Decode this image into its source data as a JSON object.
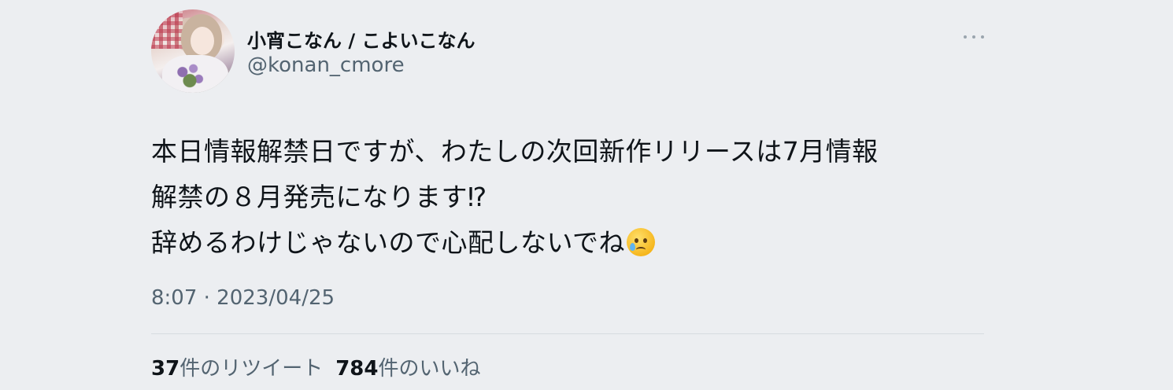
{
  "tweet": {
    "author": {
      "name": "小宵こなん / こよいこなん",
      "handle": "@konan_cmore"
    },
    "text_lines": [
      "本日情報解禁日ですが、わたしの次回新作リリースは7月情報",
      "解禁の８月発売になります⁉︎",
      "辞めるわけじゃないので心配しないでね"
    ],
    "emoji": "face-holding-back-tears",
    "timestamp": "8:07 · 2023/04/25",
    "retweets": {
      "count": "37",
      "label": "件のリツイート"
    },
    "likes": {
      "count": "784",
      "label": "件のいいね"
    }
  }
}
